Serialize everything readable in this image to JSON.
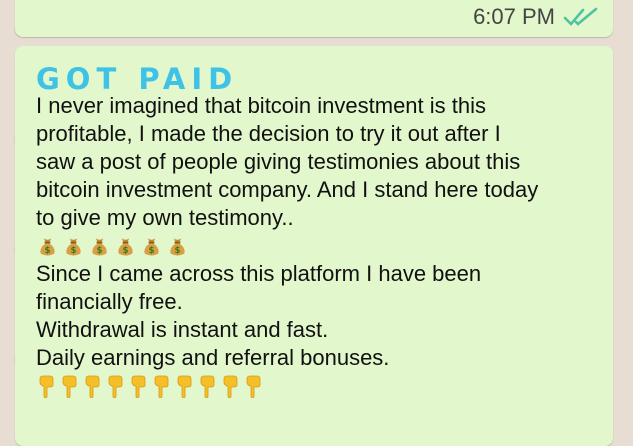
{
  "message_top": {
    "time": "6:07 PM",
    "status_icon": "double-check-read-icon",
    "status_color": "#4fc3a1"
  },
  "message_main": {
    "headline": "GOT PAID",
    "headline_color": "#3ec3e6",
    "lines": [
      "I never imagined that bitcoin investment is this",
      "profitable, I made the decision to try it out after I",
      "saw a post of people giving testimonies about this",
      "bitcoin investment company. And I stand here today",
      "to give my own testimony.."
    ],
    "money_bag_emoji_count": 6,
    "lines_after": [
      "Since I came across this platform I have been",
      "financially free.",
      "Withdrawal is instant and fast.",
      "Daily earnings and referral bonuses."
    ],
    "pointing_down_emoji_count": 10
  },
  "colors": {
    "bubble": "#e2f7cb",
    "background": "#e7ddd3"
  }
}
